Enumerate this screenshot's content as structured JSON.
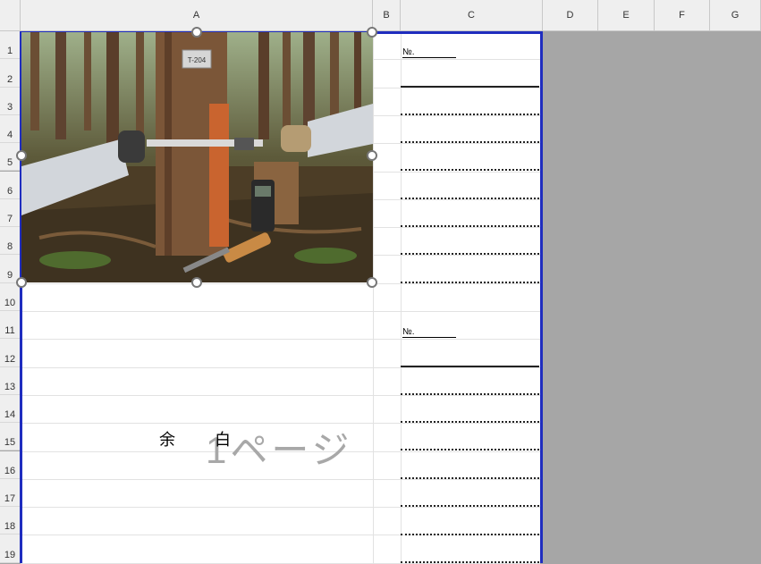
{
  "columns": [
    "A",
    "B",
    "C",
    "D",
    "E",
    "F",
    "G"
  ],
  "rows": [
    "1",
    "2",
    "3",
    "4",
    "5",
    "6",
    "7",
    "8",
    "9",
    "10",
    "11",
    "12",
    "13",
    "14",
    "15",
    "16",
    "17",
    "18",
    "19"
  ],
  "cells": {
    "c1_no": "№.",
    "c11_no": "№.",
    "margin_left": "余",
    "margin_right": "白",
    "watermark": "1ページ"
  },
  "image": {
    "tag_text": "T-204",
    "description_icon": "forest-tree-measurement-photo"
  },
  "colors": {
    "page_break": "#1f2dbf",
    "outside_area": "#a6a6a6",
    "header_bg": "#efefef"
  }
}
